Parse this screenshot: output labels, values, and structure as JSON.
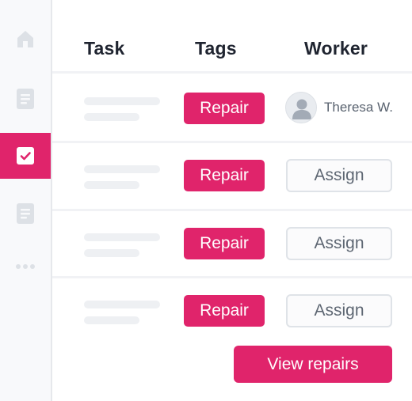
{
  "sidebar": {
    "items": [
      {
        "icon": "home-icon",
        "active": false
      },
      {
        "icon": "document-icon",
        "active": false
      },
      {
        "icon": "checkbox-icon",
        "active": true
      },
      {
        "icon": "document-icon",
        "active": false
      },
      {
        "icon": "more-icon",
        "active": false
      }
    ]
  },
  "table": {
    "headers": {
      "task": "Task",
      "tags": "Tags",
      "worker": "Worker"
    },
    "rows": [
      {
        "tag": "Repair",
        "worker": {
          "type": "assigned",
          "name": "Theresa W."
        }
      },
      {
        "tag": "Repair",
        "worker": {
          "type": "button",
          "label": "Assign"
        }
      },
      {
        "tag": "Repair",
        "worker": {
          "type": "button",
          "label": "Assign"
        }
      },
      {
        "tag": "Repair",
        "worker": {
          "type": "button",
          "label": "Assign"
        }
      }
    ]
  },
  "actions": {
    "view_repairs": "View repairs"
  },
  "colors": {
    "accent": "#e0246b",
    "sidebar_bg": "#f8f9fb",
    "placeholder": "#eef0f3",
    "text_dark": "#1f2430",
    "text_muted": "#5d6672"
  }
}
